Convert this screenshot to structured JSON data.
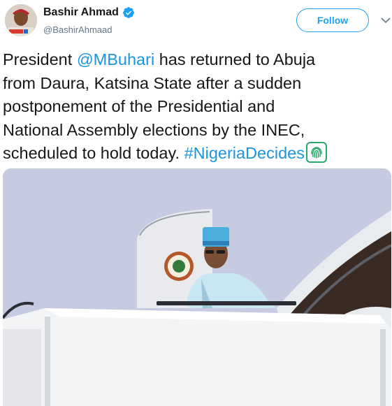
{
  "user": {
    "display_name": "Bashir Ahmad",
    "handle": "@BashirAhmaad",
    "verified": true,
    "avatar_icon": "profile-photo"
  },
  "actions": {
    "follow_label": "Follow",
    "more_icon": "chevron-down-icon"
  },
  "tweet": {
    "text_1": "President ",
    "mention": "@MBuhari",
    "text_2": " has returned to Abuja\nfrom Daura, Katsina State after a sudden\npostponement of the Presidential and\nNational Assembly elections by the INEC,\nscheduled to hold today. ",
    "hashtag": "#NigeriaDecides",
    "hashtag_emoji_icon": "fingerprint-icon"
  },
  "colors": {
    "link": "#1b95e0",
    "accent": "#1da1f2",
    "secondary_text": "#657786",
    "text": "#14171a"
  },
  "media": {
    "type": "photo",
    "subject": "man in white attire and blue cap at aircraft door on airstairs"
  }
}
